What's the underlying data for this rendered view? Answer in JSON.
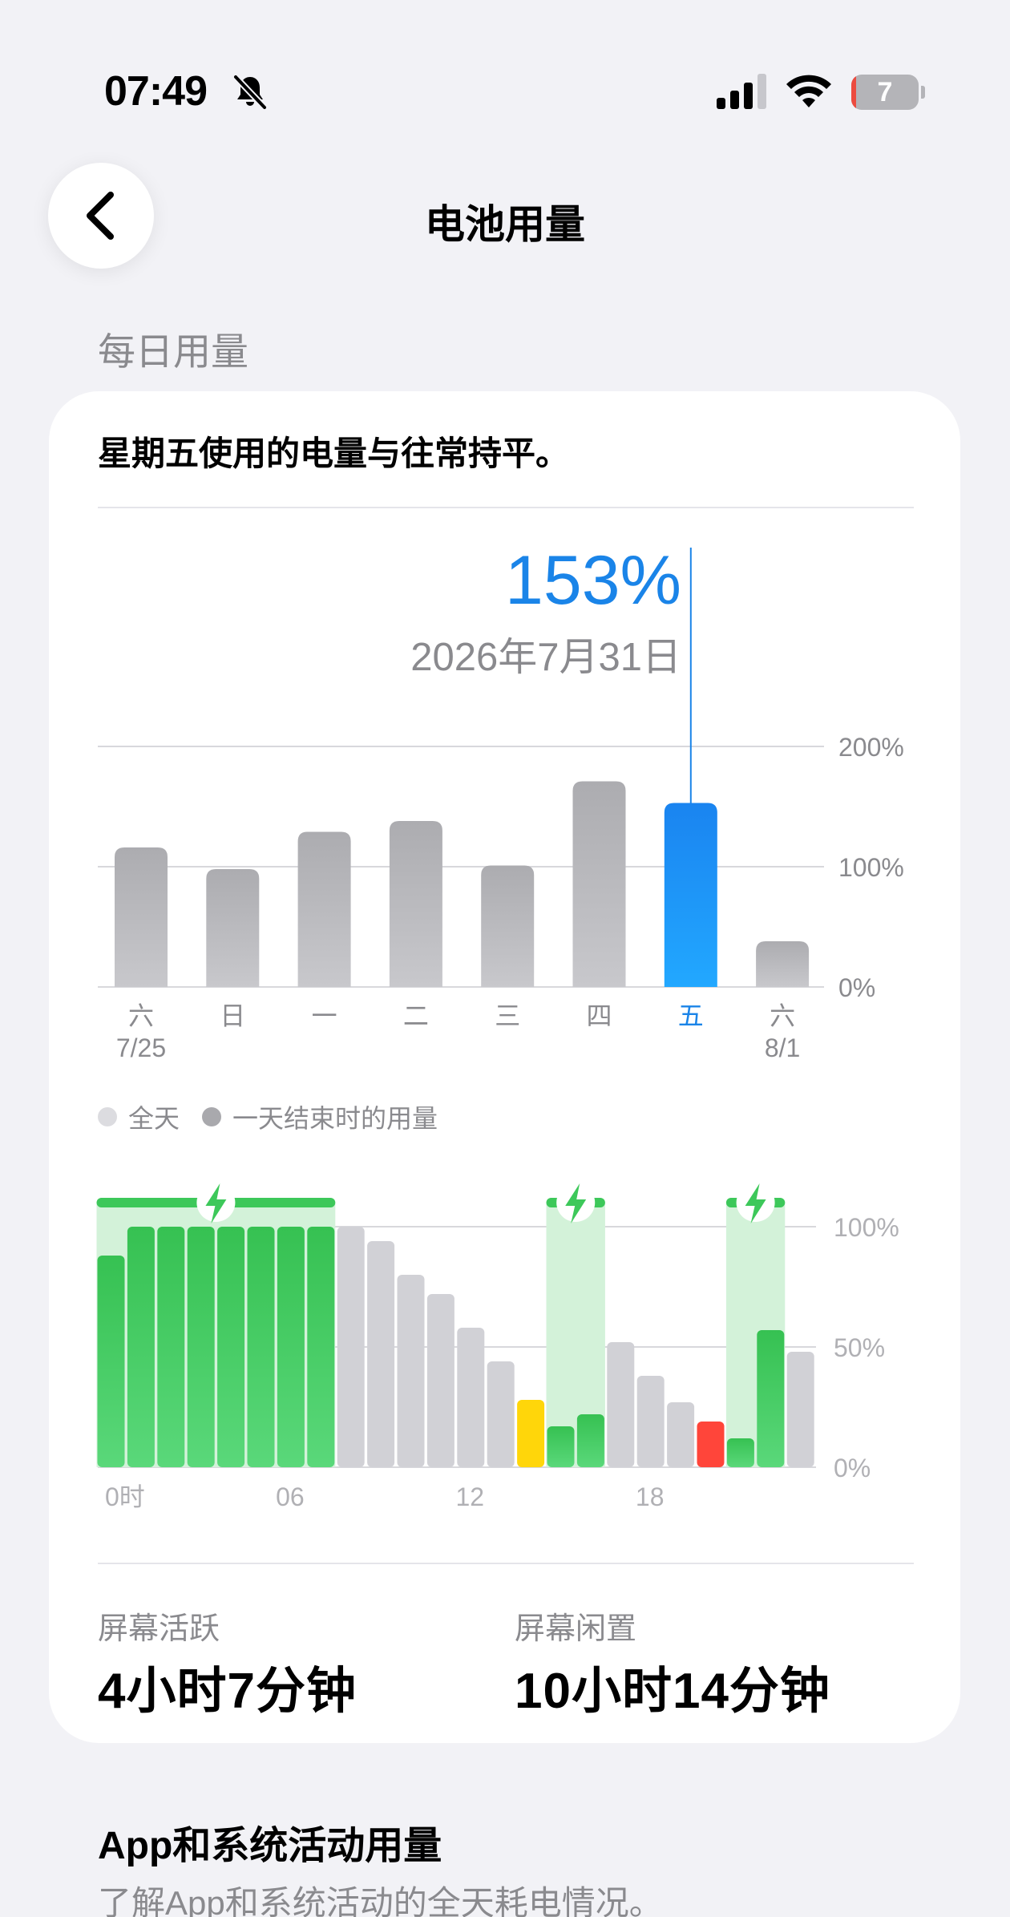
{
  "status_bar": {
    "time": "07:49",
    "battery_level": "7",
    "battery_fraction": 0.07
  },
  "nav": {
    "title": "电池用量"
  },
  "section_label": "每日用量",
  "card": {
    "summary": "星期五使用的电量与往常持平。",
    "selected_value": "153%",
    "selected_date": "2026年7月31日",
    "legend": {
      "all_day": "全天",
      "end_of_day": "一天结束时的用量"
    },
    "screen_active": {
      "label": "屏幕活跃",
      "value": "4小时7分钟"
    },
    "screen_idle": {
      "label": "屏幕闲置",
      "value": "10小时14分钟"
    }
  },
  "colors": {
    "accent": "#1a84e8",
    "bar_gray": "#b3b3b7",
    "green": "#3dc85a",
    "yellow": "#ffd60a",
    "red": "#ff453a",
    "light_gray": "#d1d1d6"
  },
  "chart_data": [
    {
      "type": "bar",
      "categories": [
        "六",
        "日",
        "一",
        "二",
        "三",
        "四",
        "五",
        "六"
      ],
      "category_dates": [
        "7/25",
        "",
        "",
        "",
        "",
        "",
        "",
        "8/1"
      ],
      "values": [
        116,
        98,
        129,
        138,
        101,
        171,
        153,
        38
      ],
      "selected_index": 6,
      "y_ticks": [
        "200%",
        "100%",
        "0%"
      ],
      "ylim": [
        0,
        200
      ]
    },
    {
      "type": "bar",
      "x_ticks": [
        "0时",
        "06",
        "12",
        "18"
      ],
      "y_ticks": [
        "100%",
        "50%",
        "0%"
      ],
      "ylim": [
        0,
        100
      ],
      "values": [
        88,
        100,
        100,
        100,
        100,
        100,
        100,
        100,
        100,
        94,
        80,
        72,
        58,
        44,
        28,
        17,
        22,
        52,
        38,
        27,
        19,
        12,
        57,
        48
      ],
      "bar_states": [
        "charging",
        "charging",
        "charging",
        "charging",
        "charging",
        "charging",
        "charging",
        "charging",
        "normal",
        "normal",
        "normal",
        "normal",
        "normal",
        "normal",
        "low",
        "charging",
        "charging",
        "normal",
        "normal",
        "normal",
        "critical",
        "charging",
        "charging",
        "normal"
      ],
      "charging_periods": [
        [
          0,
          8
        ],
        [
          15,
          17
        ],
        [
          21,
          23
        ]
      ]
    }
  ],
  "section_app": {
    "title": "App和系统活动用量",
    "description": "了解App和系统活动的全天耗电情况。"
  }
}
